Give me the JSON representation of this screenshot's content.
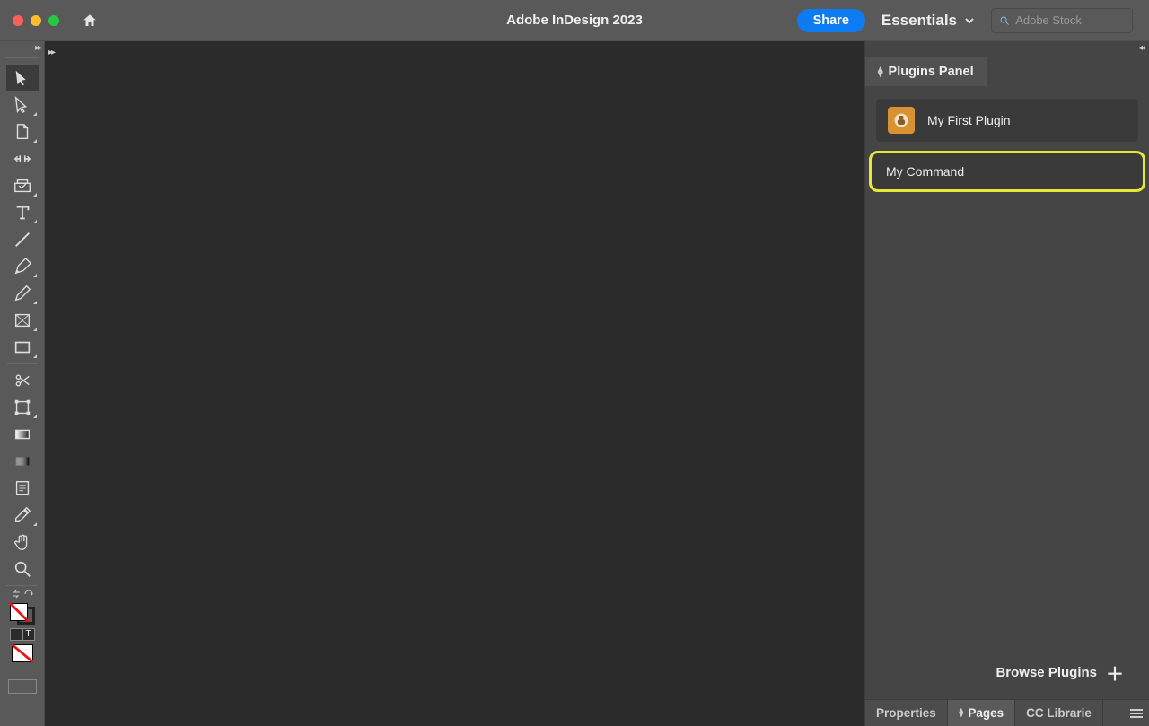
{
  "titlebar": {
    "app_title": "Adobe InDesign 2023",
    "share_label": "Share",
    "workspace_label": "Essentials",
    "stock_placeholder": "Adobe Stock"
  },
  "tools": [
    {
      "name": "selection-tool",
      "selected": true,
      "flyout": false
    },
    {
      "name": "direct-selection-tool",
      "selected": false,
      "flyout": true
    },
    {
      "name": "page-tool",
      "selected": false,
      "flyout": true
    },
    {
      "name": "gap-tool",
      "selected": false,
      "flyout": false
    },
    {
      "name": "content-collector-tool",
      "selected": false,
      "flyout": true
    },
    {
      "name": "type-tool",
      "selected": false,
      "flyout": true
    },
    {
      "name": "line-tool",
      "selected": false,
      "flyout": false
    },
    {
      "name": "pen-tool",
      "selected": false,
      "flyout": true
    },
    {
      "name": "pencil-tool",
      "selected": false,
      "flyout": true
    },
    {
      "name": "rectangle-frame-tool",
      "selected": false,
      "flyout": true
    },
    {
      "name": "rectangle-tool",
      "selected": false,
      "flyout": true
    },
    {
      "name": "scissors-tool",
      "selected": false,
      "flyout": false
    },
    {
      "name": "free-transform-tool",
      "selected": false,
      "flyout": true
    },
    {
      "name": "gradient-swatch-tool",
      "selected": false,
      "flyout": false
    },
    {
      "name": "gradient-feather-tool",
      "selected": false,
      "flyout": false
    },
    {
      "name": "note-tool",
      "selected": false,
      "flyout": false
    },
    {
      "name": "eyedropper-tool",
      "selected": false,
      "flyout": true
    },
    {
      "name": "hand-tool",
      "selected": false,
      "flyout": false
    },
    {
      "name": "zoom-tool",
      "selected": false,
      "flyout": false
    }
  ],
  "plugins_panel": {
    "tab_label": "Plugins Panel",
    "plugin_name": "My First Plugin",
    "command_name": "My Command",
    "browse_label": "Browse Plugins"
  },
  "bottom_panel_tabs": {
    "properties": "Properties",
    "pages": "Pages",
    "cclib": "CC Librarie"
  }
}
